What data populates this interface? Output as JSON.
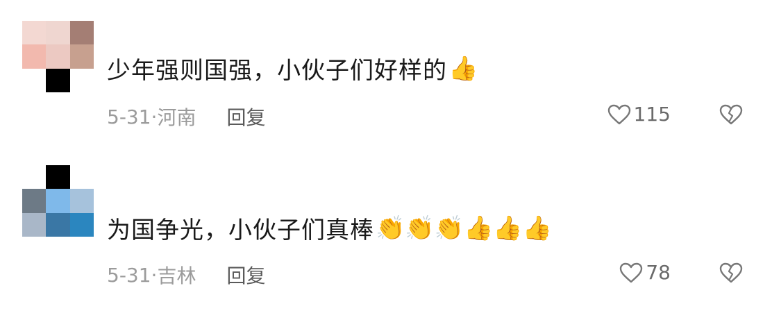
{
  "comments": [
    {
      "text": "少年强则国强，小伙子们好样的",
      "emojis": "👍",
      "date": "5-31",
      "separator": "·",
      "location": "河南",
      "reply_label": "回复",
      "like_count": "115",
      "avatar_colors": [
        "#f3d8d2",
        "#efd6d0",
        "#a47e74",
        "#f2b9ae",
        "#ecc9c2",
        "#c7a08f",
        "#ffffff",
        "#000000",
        "#ffffff"
      ]
    },
    {
      "text": "为国争光，小伙子们真棒",
      "emojis": "👏👏👏👍👍👍",
      "date": "5-31",
      "separator": "·",
      "location": "吉林",
      "reply_label": "回复",
      "like_count": "78",
      "avatar_colors": [
        "#ffffff",
        "#000000",
        "#ffffff",
        "#6d7a86",
        "#7fb9ea",
        "#a6c2dc",
        "#a9b7c8",
        "#3a77a5",
        "#2b86bf"
      ]
    }
  ],
  "icons": {
    "like": "heart-outline-icon",
    "dislike": "broken-heart-icon"
  }
}
